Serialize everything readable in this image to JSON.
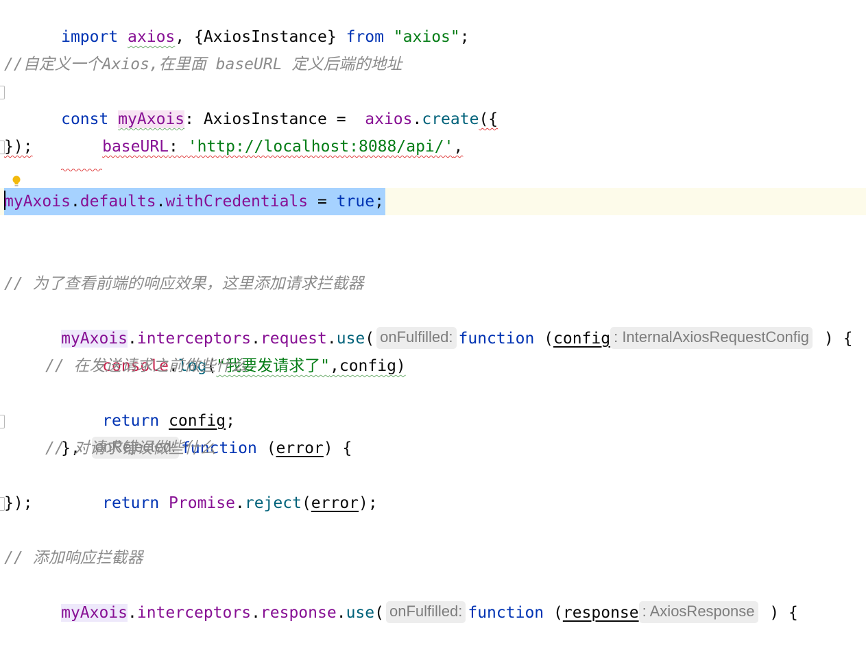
{
  "editor": {
    "line1": {
      "import": "import",
      "axios": "axios",
      "sep": ", {",
      "instance": "AxiosInstance",
      "close": "} ",
      "from": "from",
      "space": " ",
      "module": "\"axios\"",
      "end": ";"
    },
    "line3": {
      "comment": "//自定义一个Axios,在里面 baseURL 定义后端的地址"
    },
    "line4": {
      "const": "const",
      "name": "myAxois",
      "type": ": AxiosInstance =  ",
      "axios": "axios",
      "dot": ".",
      "create": "create",
      "open": "({"
    },
    "line5": {
      "key": "baseURL",
      "colon": ": ",
      "url": "'http://localhost:8088/api/'",
      "comma": ","
    },
    "line6": {
      "text": "});"
    },
    "line8": {
      "obj": "myAxois",
      "dot1": ".",
      "defaults": "defaults",
      "dot2": ".",
      "prop": "withCredentials",
      "eq": " = ",
      "val": "true",
      "end": ";"
    },
    "line11": {
      "comment": "// 为了查看前端的响应效果，这里添加请求拦截器"
    },
    "line12": {
      "obj": "myAxois",
      "dot1": ".",
      "interceptors": "interceptors",
      "dot2": ".",
      "request": "request",
      "dot3": ".",
      "use": "use",
      "open": "(",
      "hint1": "onFulfilled:",
      "function": "function",
      "paren": " (",
      "param": "config",
      "hint2": ": InternalAxiosRequestConfig",
      "close": " ) {"
    },
    "line13": {
      "console": "console",
      "dot": ".",
      "log": "log",
      "open": "(",
      "msg": "\"我要发请求了\"",
      "rest": ",config)"
    },
    "line14": {
      "comment": "// 在发送请求之前做些什么"
    },
    "line15": {
      "return": "return",
      "space": " ",
      "param": "config",
      "end": ";"
    },
    "line16": {
      "open": "}, ",
      "hint": "onRejected:",
      "function": "function",
      "paren": " (",
      "param": "error",
      "close": ") {"
    },
    "line17": {
      "comment": "// 对请求错误做些什么"
    },
    "line18": {
      "return": "return",
      "space": " ",
      "promise": "Promise",
      "dot": ".",
      "reject": "reject",
      "open": "(",
      "param": "error",
      "close": ");"
    },
    "line19": {
      "text": "});"
    },
    "line21": {
      "comment": "// 添加响应拦截器"
    },
    "line22": {
      "obj": "myAxois",
      "dot1": ".",
      "interceptors": "interceptors",
      "dot2": ".",
      "response": "response",
      "dot3": ".",
      "use": "use",
      "open": "(",
      "hint1": "onFulfilled:",
      "function": "function",
      "paren": " (",
      "param": "response",
      "hint2": ": AxiosResponse",
      "close": " ) {"
    }
  },
  "colors": {
    "keyword": "#0033b3",
    "variable": "#871094",
    "function": "#00627a",
    "string": "#067d17",
    "comment": "#8c8c8c",
    "selection": "#a6d2ff",
    "current_line": "#fdfbea"
  },
  "icons": {
    "intention": "lightbulb-icon",
    "fold": "fold-marker-icon"
  }
}
